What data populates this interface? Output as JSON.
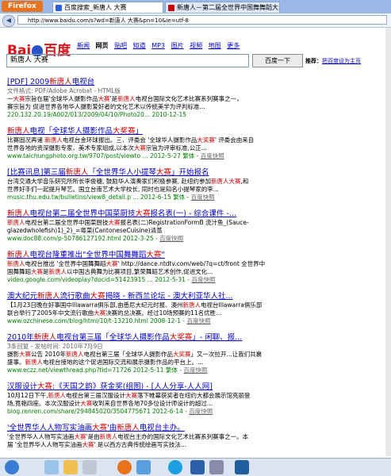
{
  "browser": {
    "menu_label": "Firefox",
    "tabs": [
      {
        "title": "百度搜索_新唐人 大赛"
      },
      {
        "title": "新唐人－第二届全世界中国舞舞蹈大..."
      }
    ],
    "url": "http://www.baidu.com/s?wd=新唐人 大赛&pn=10&ie=utf-8"
  },
  "baidu": {
    "logo_text": "Bai百度",
    "nav": [
      "新闻",
      "网页",
      "贴吧",
      "知道",
      "MP3",
      "图片",
      "视频",
      "地图",
      "更多"
    ],
    "nav_current": "网页",
    "query": "新唐人 大赛",
    "search_button": "百度一下",
    "tip_label": "推荐：",
    "tip_link": "把百度设为主页"
  },
  "results": [
    {
      "title": "[PDF] 2009新唐人电视台",
      "meta": "文件格式: PDF/Adobe Acrobat - HTML版",
      "snippet": "一大赛宗旨在届'全球华人摄影作品大赛'是新唐人电视台国际文化艺术比赛系列赛事之一，",
      "snippet2": "赛宗旨为 促进世界各地华人摄影爱好者的文化艺术以传统美学为评判标准...",
      "url": "220.132.20.19/A002/013/2009/04/10/Photo20... 2010-12-15"
    },
    {
      "title": "新唐人电视「全球华人摄影作品大奖赛」",
      "meta": "",
      "snippet": "比赛固况再诸 新唐人电视台金环球报出。三、评委会 '全球华人摄影作品大奖赛' 评委会由来自",
      "snippet2": "世界各地的资深摄影专家、美术专家组成,以本次大赛宗旨为评审标准,公正...",
      "url": "www.taichungphoto.org.tw/9707/post/viewto ... 2012-5-27 繁体 - 百度快照"
    },
    {
      "title": "[比赛讯息]第三届新唐人「全世界华人小提琴大赛」开始报名",
      "meta": "",
      "snippet": "台湾交通大学音乐研究所所长李俊穗, 鼓励华人演奏家们积极参赛, 赴纽约参加新唐人大赛,和",
      "snippet2": "世界好手们一起提升琴艺。国立台南艺术大学校长, 同时也是知名小提琴家的李...",
      "url": "music.thu.edu.tw/bulletins/view8_detail.p ... 2012-6-15 繁体 - 百度快照"
    },
    {
      "title": "新唐人电视台第二届全世界中国菜厨技大赛报名表(一) - 综合课件 -...",
      "meta": "",
      "snippet": "新唐人电视台第二届全世界中国菜厨技大赛报名表(二)RegistrationFormB 流汁鱼_(Sauce-",
      "snippet2": "glazedwholefish)1)_2)_=粤菜(CantoneseCuisine)清蒸",
      "url": "www.doc88.com/p-50786127192.html 2012-3-25 - 百度快照"
    },
    {
      "title": "新唐人电视台隆重推出\"全世界中国舞舞蹈大赛\"",
      "meta": "",
      "snippet": "新唐人电视台推出 '全世界中国舞舞蹈大赛' http://dance.ntdtv.com/web/?q=ct/front 全世界中",
      "snippet2": "国舞舞蹈大赛是新唐人以中国古典舞为比赛项目,繁荣舞蹈艺术创作,促进文化...",
      "url": "video.google.com/videoplay?docid=51423915 ... 2012-5-31 - 百度快照"
    },
    {
      "title": "澳大纪元新唐人流行歌曲大赛揭晓 - 新西兰论坛 - 澳大利亚华人社...",
      "meta": "",
      "snippet": "【1月23日晚在好事国中Illawarra俱乐部,由悉尼大纪元时报、澳州新唐人电视台Illawarra俱乐部",
      "snippet2": "联合举行了2005年中文流行歌曲大赛决赛的总决赛。经过10场预赛的11名优胜...",
      "url": "www.ozchinese.com/blog/html/10/t-13210.html 2008-12-1 - 百度快照"
    },
    {
      "title": "2010年新唐人电视台第三届「全球华人摄影作品大奖赛」- 闲聊、报...",
      "meta": "3条回复 - 发帖时间: 2010年7月9日",
      "snippet": "摄影大赛公告 2010年新唐人电视台第三届「全球华人摄影作品大奖赛」又一次拉开...让我们共襄",
      "snippet2": "盛事。新唐人电视台接地的这个促进国际交流和展示摄影作品的平台上。...",
      "url": "www.eczz.net/viewthread.php?tid=71726 2012-5-11 繁体 - 百度快照"
    },
    {
      "title": "汉服设计大赛:《天国之韵》获金奖(组图) - [人人分享-人人网]",
      "meta": "",
      "snippet": "10月12日下午,新唐人电视台第三届汉服设计大赛落下帷幕获奖者在纽约大都会展示馆亮丽登",
      "snippet2": "场,竟艳四座。本次汉服设计大赛收到来自世界各地70多位设计师设计的超过...",
      "url": "blog.renren.com/share/294845020/3504775671 2012-6-14 - 百度快照"
    },
    {
      "title": "'全世界华人人物写实油画大赛'由新唐人电视台主办。",
      "meta": "",
      "snippet": "'全世界华人人物写实油画大赛'是由新唐人电视台主办的国际文化艺术比赛系列赛事之一。本",
      "snippet2": "届 '全世界华人人物写实油画大赛' 是以西方古典传统绘画写实技法...",
      "url": ""
    }
  ]
}
